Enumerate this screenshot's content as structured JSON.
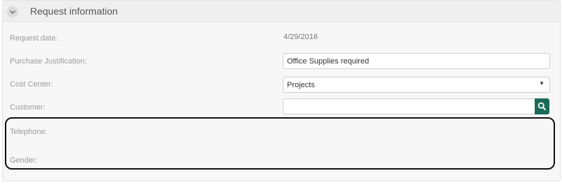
{
  "section": {
    "title": "Request information"
  },
  "fields": {
    "request_date": {
      "label": "Request date:",
      "value": "4/29/2016"
    },
    "purchase_justification": {
      "label": "Purchase Justification:",
      "value": "Office Supplies required"
    },
    "cost_center": {
      "label": "Cost Center:",
      "value": "Projects"
    },
    "customer": {
      "label": "Customer:",
      "value": ""
    },
    "telephone": {
      "label": "Telephone:"
    },
    "gender": {
      "label": "Gender:"
    }
  },
  "icons": {
    "collapse": "chevron-down-icon",
    "search": "search-icon",
    "dropdown": "caret-down-icon"
  },
  "colors": {
    "accent": "#1c6b58",
    "label": "#9a9a9a",
    "panel_bg": "#f7f7f7"
  }
}
